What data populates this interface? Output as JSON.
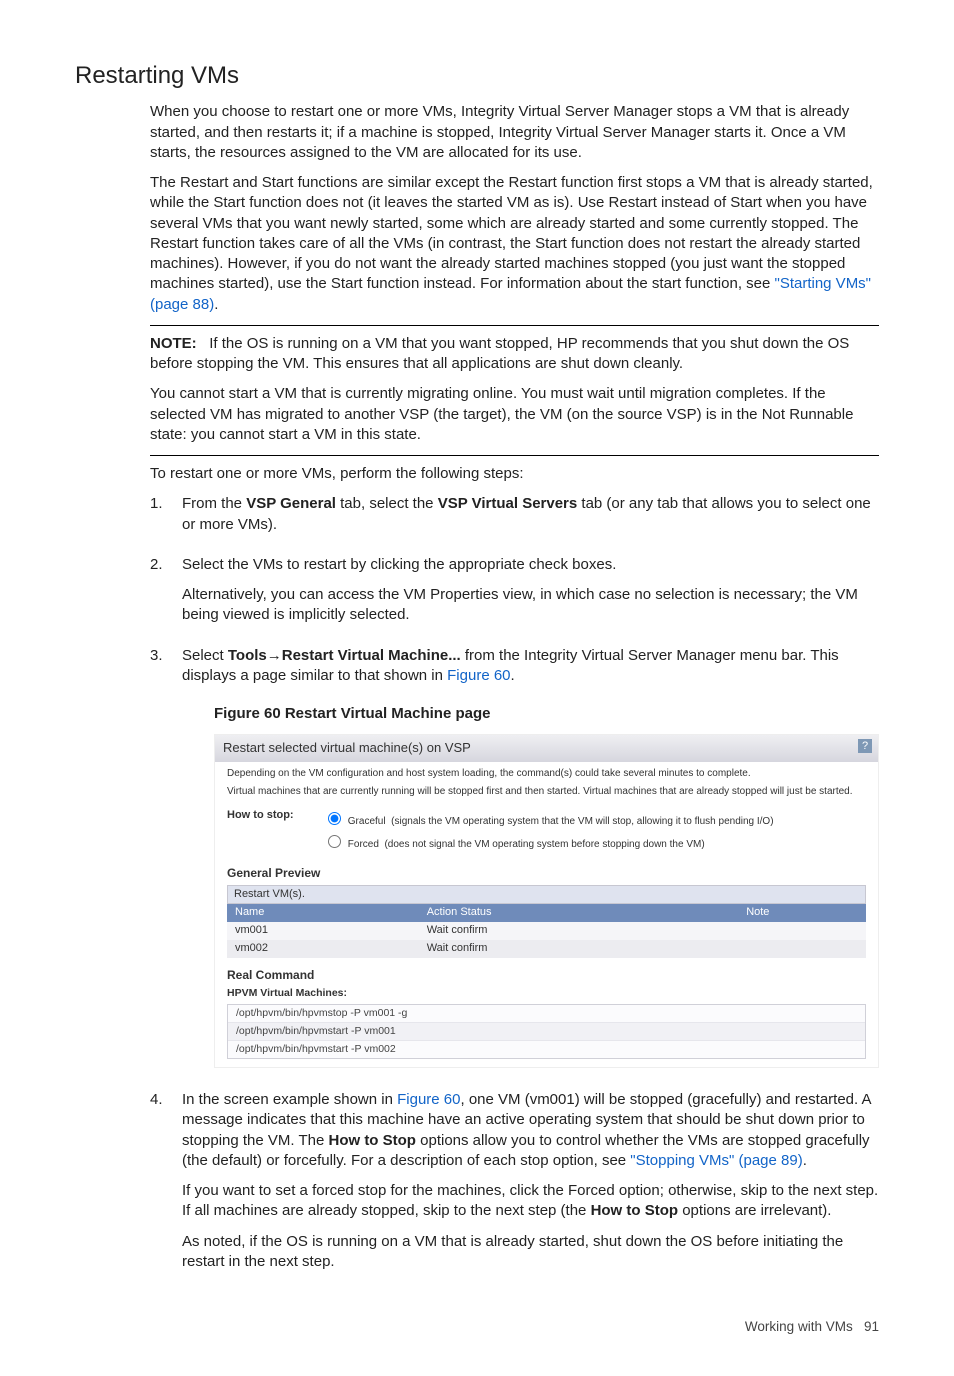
{
  "title": "Restarting VMs",
  "p1": "When you choose to restart one or more VMs, Integrity Virtual Server Manager stops a VM that is already started, and then restarts it; if a machine is stopped, Integrity Virtual Server Manager starts it. Once a VM starts, the resources assigned to the VM are allocated for its use.",
  "p2a": "The Restart and Start functions are similar except the Restart function first stops a VM that is already started, while the Start function does not (it leaves the started VM as is). Use Restart instead of Start when you have several VMs that you want newly started, some which are already started and some currently stopped. The Restart function takes care of all the VMs (in contrast, the Start function does not restart the already started machines). However, if you do not want the already started machines stopped (you just want the stopped machines started), use the Start function instead. For information about the start function, see ",
  "p2link": "\"Starting VMs\" (page 88)",
  "p2b": ".",
  "note_label": "NOTE:",
  "note_text": "If the OS is running on a VM that you want stopped, HP recommends that you shut down the OS before stopping the VM. This ensures that all applications are shut down cleanly.",
  "p3": "You cannot start a VM that is currently migrating online. You must wait until migration completes. If the selected VM has migrated to another VSP (the target), the VM (on the source VSP) is in the Not Runnable state: you cannot start a VM in this state.",
  "p4": "To restart one or more VMs, perform the following steps:",
  "steps": {
    "s1a": "From the ",
    "s1b": "VSP General",
    "s1c": " tab, select the ",
    "s1d": "VSP Virtual Servers",
    "s1e": " tab (or any tab that allows you to select one or more VMs).",
    "s2": "Select the VMs to restart by clicking the appropriate check boxes.",
    "s2p": "Alternatively, you can access the VM Properties view, in which case no selection is necessary; the VM being viewed is implicitly selected.",
    "s3a": "Select ",
    "s3b": "Tools",
    "s3arrow": "→",
    "s3c": "Restart Virtual Machine...",
    "s3d": " from the Integrity Virtual Server Manager menu bar. This displays a page similar to that shown in ",
    "s3link": "Figure 60",
    "s3e": ".",
    "s4a": "In the screen example shown in ",
    "s4link": "Figure 60",
    "s4b": ", one VM (vm001) will be stopped (gracefully) and restarted. A message indicates that this machine have an active operating system that should be shut down prior to stopping the VM. The ",
    "s4c": "How to Stop",
    "s4d": " options allow you to control whether the VMs are stopped gracefully (the default) or forcefully. For a description of each stop option, see ",
    "s4link2": "\"Stopping VMs\" (page 89)",
    "s4e": ".",
    "s4p2a": "If you want to set a forced stop for the machines, click the Forced option; otherwise, skip to the next step. If all machines are already stopped, skip to the next step (the ",
    "s4p2b": "How to Stop",
    "s4p2c": " options are irrelevant).",
    "s4p3": "As noted, if the OS is running on a VM that is already started, shut down the OS before initiating the restart in the next step."
  },
  "figcaption": "Figure 60 Restart Virtual Machine page",
  "fig": {
    "titlebar": "Restart selected virtual machine(s) on VSP",
    "help": "?",
    "line1": "Depending on the VM configuration and host system loading, the command(s) could take several minutes to complete.",
    "line2": "Virtual machines that are currently running will be stopped first and then started. Virtual machines that are already stopped will just be started.",
    "how_label": "How to stop:",
    "graceful": "Graceful",
    "graceful_note": "(signals the VM operating system that the VM will stop, allowing it to flush pending I/O)",
    "forced": "Forced",
    "forced_note": "(does not signal the VM operating system before stopping down the VM)",
    "gp": "General Preview",
    "tblcap": "Restart VM(s).",
    "th_name": "Name",
    "th_action": "Action Status",
    "th_note": "Note",
    "rows": [
      {
        "name": "vm001",
        "status": "Wait confirm",
        "note": ""
      },
      {
        "name": "vm002",
        "status": "Wait confirm",
        "note": ""
      }
    ],
    "rc": "Real Command",
    "rc_sub": "HPVM Virtual Machines:",
    "cmds": [
      "/opt/hpvm/bin/hpvmstop -P vm001 -g",
      "/opt/hpvm/bin/hpvmstart -P vm001",
      "/opt/hpvm/bin/hpvmstart -P vm002"
    ]
  },
  "footer_text": "Working with VMs",
  "footer_page": "91"
}
